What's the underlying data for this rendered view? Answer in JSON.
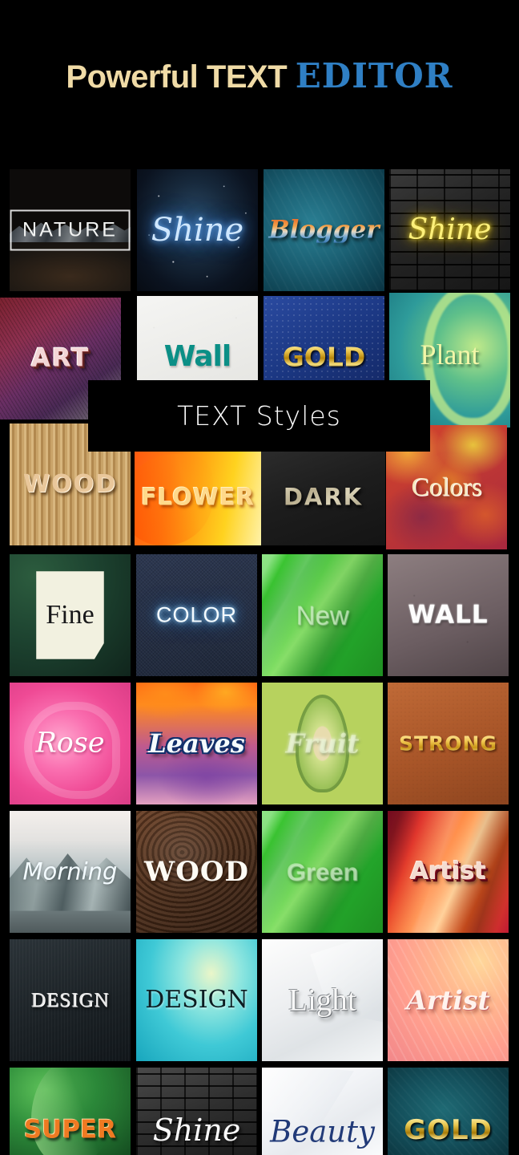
{
  "header": {
    "title_part1": "Powerful TEXT",
    "title_part2": "EDITOR",
    "color_part1": "#f0dba6",
    "color_part2": "#2f7fc4"
  },
  "overlay_banner": {
    "label": "TEXT Styles",
    "background": "#000000",
    "text_color": "#fbfbfb"
  },
  "grid": {
    "columns": 4,
    "rows": 8,
    "background": "#000000",
    "tiles": [
      {
        "label": "NATURE",
        "style": "mountain-landscape-outline-box"
      },
      {
        "label": "Shine",
        "style": "blue-glow-starry-night"
      },
      {
        "label": "Blogger",
        "style": "orange-blue-gradient-script-teal-bg"
      },
      {
        "label": "Shine",
        "style": "yellow-neon-brick-wall"
      },
      {
        "label": "ART",
        "style": "3d-layered-outline-fabric"
      },
      {
        "label": "Wall",
        "style": "teal-bold-white-plaster"
      },
      {
        "label": "GOLD",
        "style": "gold-gradient-blue-leather"
      },
      {
        "label": "Plant",
        "style": "pale-yellow-serif-green-plant"
      },
      {
        "label": "WOOD",
        "style": "embossed-cream-wood-slats"
      },
      {
        "label": "FLOWER",
        "style": "cream-outline-orange-flower"
      },
      {
        "label": "DARK",
        "style": "stone-texture-fill-dark-card"
      },
      {
        "label": "Colors",
        "style": "cream-serif-autumn-leaves"
      },
      {
        "label": "Fine",
        "style": "black-serif-paper-on-leaves"
      },
      {
        "label": "COLOR",
        "style": "blue-neon-denim"
      },
      {
        "label": "New",
        "style": "translucent-emboss-green-blade"
      },
      {
        "label": "WALL",
        "style": "white-chalk-slate"
      },
      {
        "label": "Rose",
        "style": "white-script-pink-rose"
      },
      {
        "label": "Leaves",
        "style": "white-navy-outline-script-autumn-blur"
      },
      {
        "label": "Fruit",
        "style": "translucent-script-avocado"
      },
      {
        "label": "STRONG",
        "style": "gold-gradient-brown-leather"
      },
      {
        "label": "Morning",
        "style": "thin-white-script-foggy-mountains"
      },
      {
        "label": "WOOD",
        "style": "white-serif-wood-grain"
      },
      {
        "label": "Green",
        "style": "translucent-emboss-green-blade"
      },
      {
        "label": "Artist",
        "style": "3d-red-outline-canyon"
      },
      {
        "label": "DESIGN",
        "style": "silver-serif-dark-slate"
      },
      {
        "label": "DESIGN",
        "style": "black-deco-serif-aqua-watercolor"
      },
      {
        "label": "Light",
        "style": "white-embossed-serif-white-paper"
      },
      {
        "label": "Artist",
        "style": "white-italic-serif-peach-watercolor"
      },
      {
        "label": "SUPER",
        "style": "orange-bold-green-leaf"
      },
      {
        "label": "Shine",
        "style": "white-script-brick-wall"
      },
      {
        "label": "Beauty",
        "style": "navy-calligraphy-white-paper"
      },
      {
        "label": "GOLD",
        "style": "gold-gradient-teal-texture"
      }
    ]
  }
}
